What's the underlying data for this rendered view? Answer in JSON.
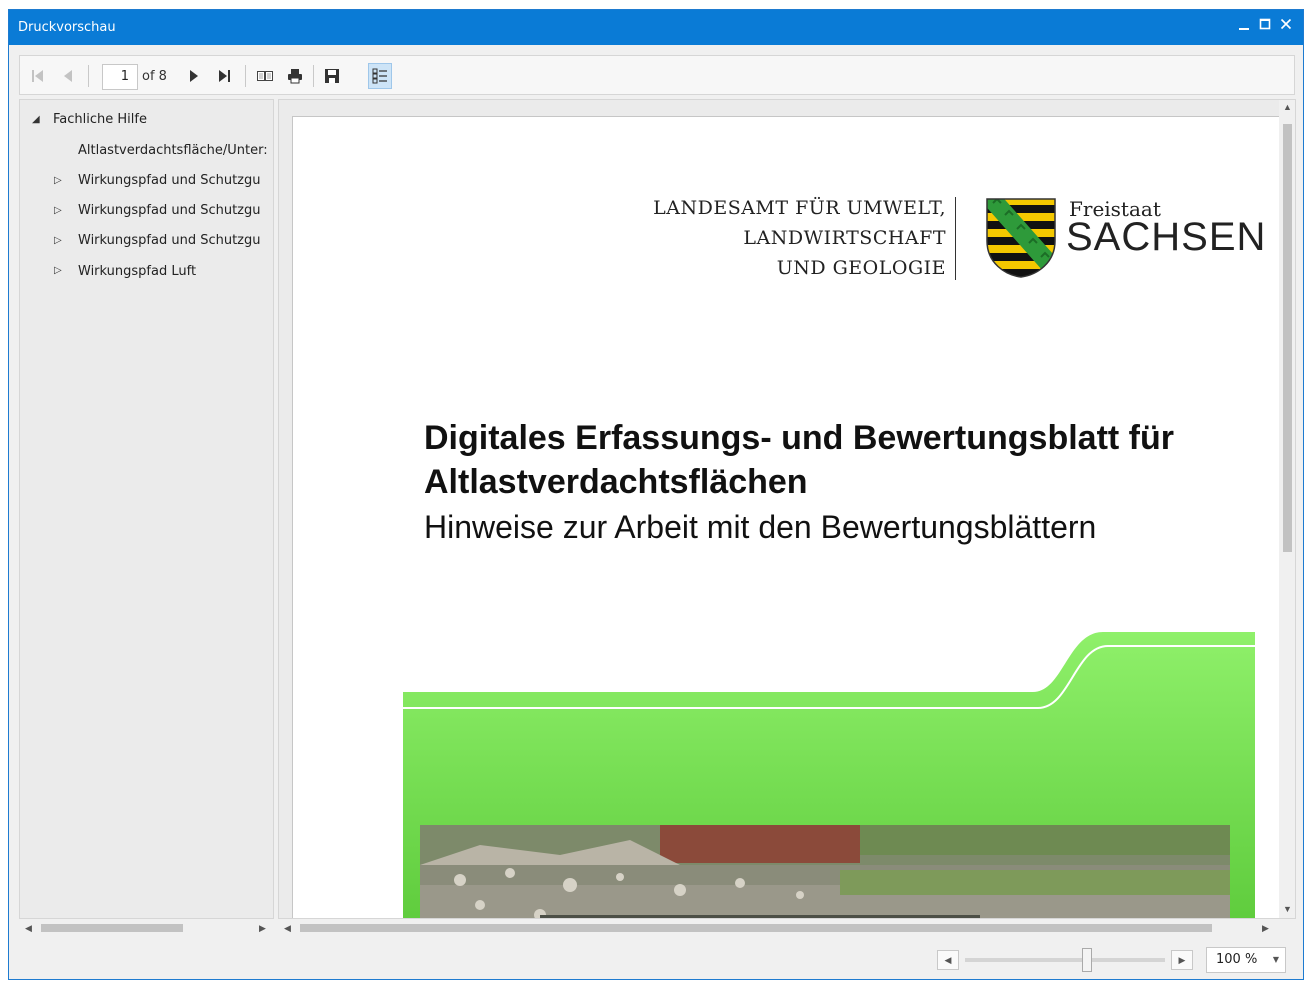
{
  "window": {
    "title": "Druckvorschau"
  },
  "toolbar": {
    "current_page": "1",
    "of_pages": "of 8"
  },
  "nav_tree": {
    "root": "Fachliche Hilfe",
    "items": [
      "Altlastverdachtsfläche/Unter:",
      "Wirkungspfad und Schutzgu",
      "Wirkungspfad und Schutzgu",
      "Wirkungspfad und Schutzgu",
      "Wirkungspfad Luft"
    ]
  },
  "document": {
    "agency_line1": "LANDESAMT FÜR UMWELT,",
    "agency_line2": "LANDWIRTSCHAFT",
    "agency_line3": "UND GEOLOGIE",
    "logo_line1": "Freistaat",
    "logo_line2": "SACHSEN",
    "title_line1": "Digitales Erfassungs- und Bewertungsblatt für",
    "title_line2": "Altlastverdachtsflächen",
    "subtitle": "Hinweise zur Arbeit mit den Bewertungsblättern"
  },
  "status": {
    "zoom": "100 %",
    "zoom_slider_level": 0.61
  },
  "colors": {
    "accent": "#0a7bd6",
    "banner_green": "#7fe85a",
    "selected_button": "#cde4f7"
  },
  "icons": [
    "first-page-icon",
    "prev-page-icon",
    "next-page-icon",
    "last-page-icon",
    "page-setup-icon",
    "print-icon",
    "save-icon",
    "document-map-icon",
    "minimize-icon",
    "maximize-icon",
    "close-icon"
  ]
}
